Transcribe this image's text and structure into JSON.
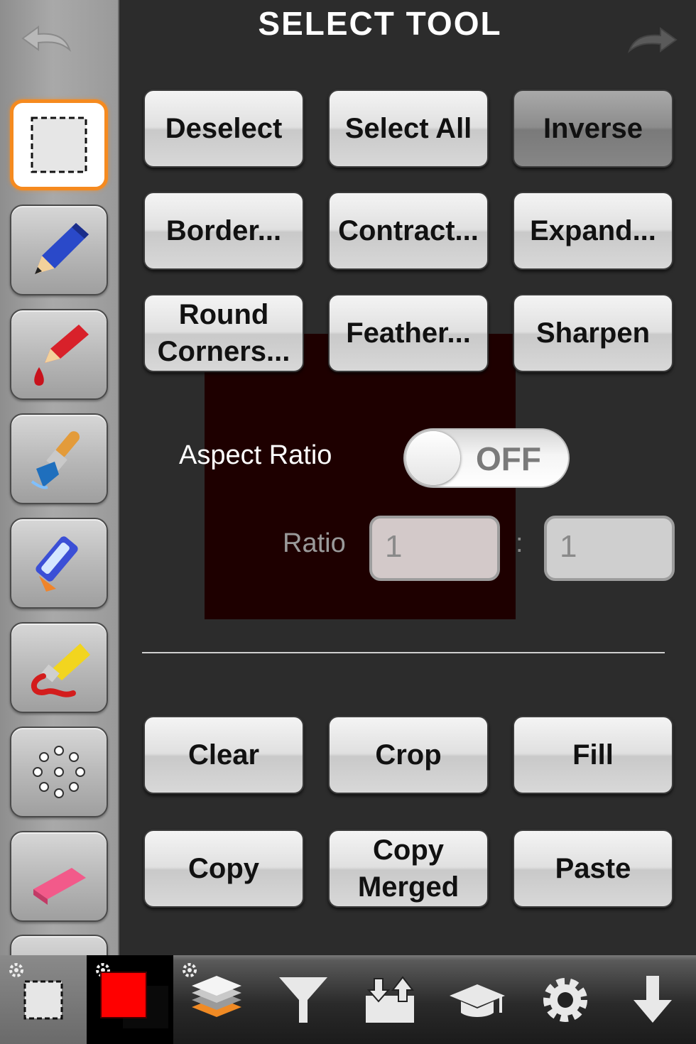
{
  "header": {
    "title": "SELECT TOOL"
  },
  "buttons": {
    "deselect": "Deselect",
    "select_all": "Select All",
    "inverse": "Inverse",
    "border": "Border...",
    "contract": "Contract...",
    "expand": "Expand...",
    "round_corners_line1": "Round",
    "round_corners_line2": "Corners...",
    "feather": "Feather...",
    "sharpen": "Sharpen",
    "clear": "Clear",
    "crop": "Crop",
    "fill": "Fill",
    "copy": "Copy",
    "copy_merged_line1": "Copy",
    "copy_merged_line2": "Merged",
    "paste": "Paste"
  },
  "aspect_ratio": {
    "label": "Aspect Ratio",
    "toggle_state": "OFF",
    "ratio_label": "Ratio",
    "ratio_width": "1",
    "ratio_separator": ":",
    "ratio_height": "1"
  },
  "sidebar": {
    "tools": [
      "selection-tool",
      "pencil-tool",
      "dropper-tool",
      "brush-tool",
      "airbrush-tool",
      "paint-tube-tool",
      "dots-brush-tool",
      "eraser-tool"
    ],
    "selected_tool": "selection-tool"
  },
  "toolbar": {
    "items": [
      "selection",
      "color",
      "layers",
      "filters",
      "import-export",
      "tutorial",
      "settings",
      "save"
    ],
    "current_color": "#ff0000"
  },
  "colors": {
    "accent": "#f58a1f",
    "background": "#2c2c2c"
  }
}
